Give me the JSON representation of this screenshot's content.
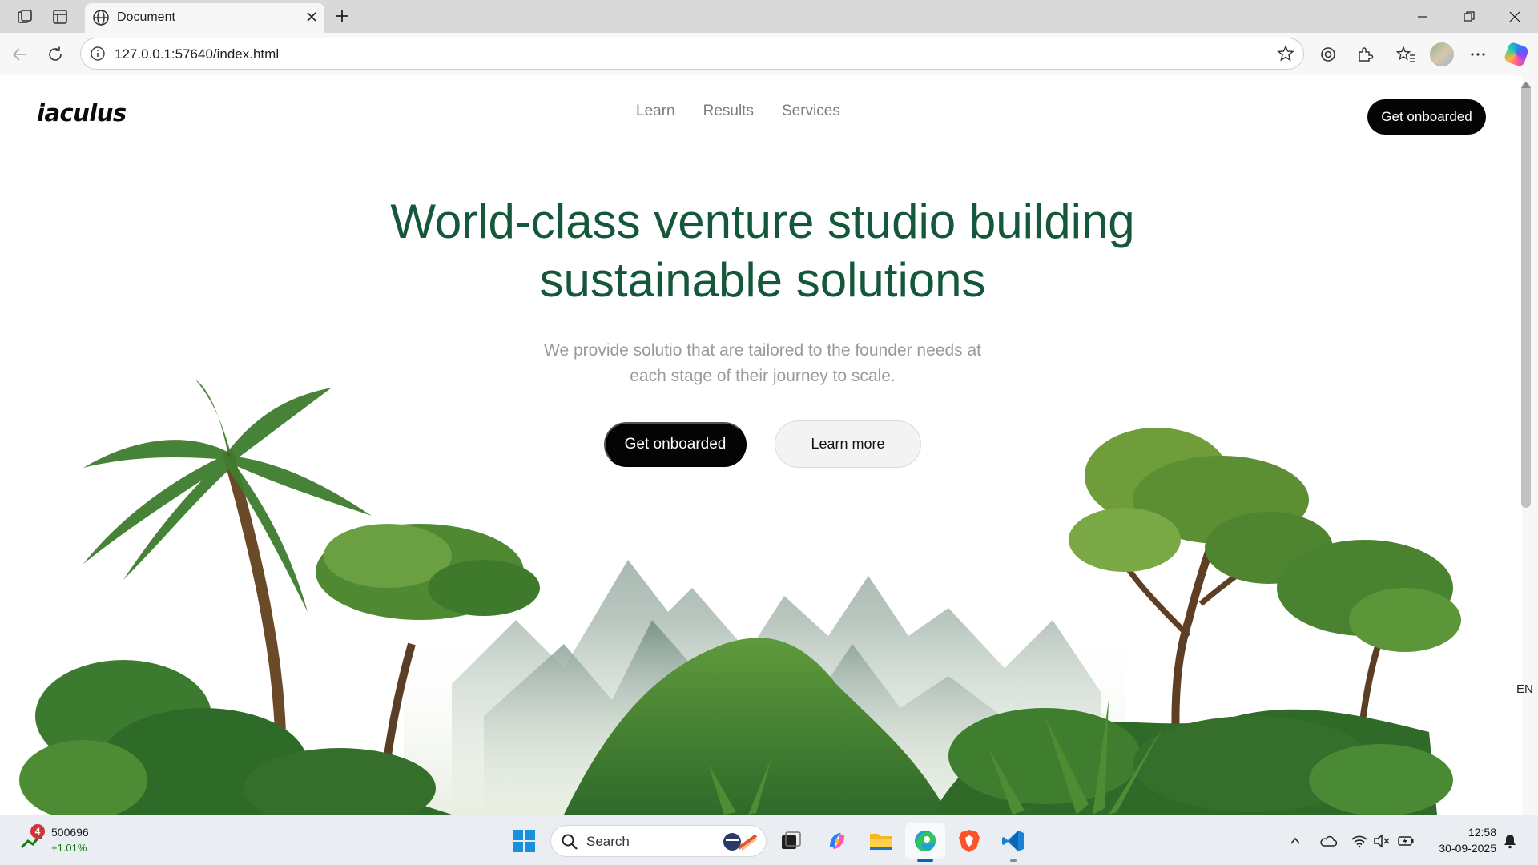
{
  "browser": {
    "tab_title": "Document",
    "url": "127.0.0.1:57640/index.html"
  },
  "site": {
    "logo": "iaculus",
    "nav": [
      {
        "label": "Learn"
      },
      {
        "label": "Results"
      },
      {
        "label": "Services"
      }
    ],
    "header_cta": "Get onboarded",
    "hero": {
      "title_line1": "World-class venture studio building",
      "title_line2": "sustainable solutions",
      "subtitle_line1": "We provide solutio that are tailored to the founder needs at",
      "subtitle_line2": "each stage of their journey to scale.",
      "primary_button": "Get onboarded",
      "secondary_button": "Learn more"
    },
    "colors": {
      "title_green": "#14573a",
      "button_black": "#040404",
      "subtitle_gray": "#9a9a9a"
    }
  },
  "side_indicator": "EN",
  "taskbar": {
    "stock_badge": "4",
    "stock_value": "500696",
    "stock_change": "+1.01%",
    "search_label": "Search",
    "time": "12:58",
    "date": "30-09-2025"
  }
}
